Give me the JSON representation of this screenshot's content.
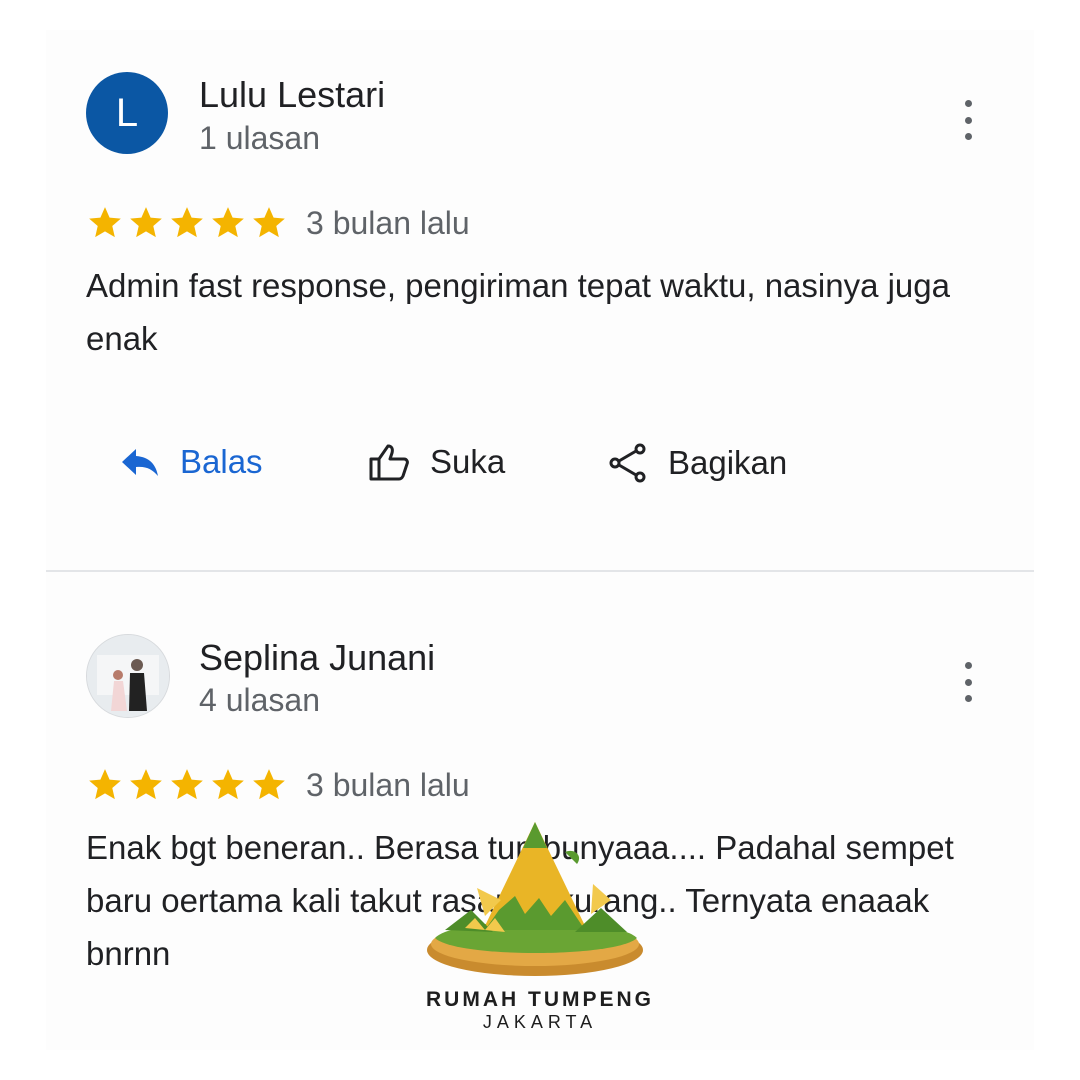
{
  "reviews": [
    {
      "name": "Lulu Lestari",
      "avatar_letter": "L",
      "review_count": "1 ulasan",
      "rating": 5,
      "date": "3 bulan lalu",
      "text": "Admin fast response, pengiriman tepat waktu, nasinya juga enak",
      "actions": {
        "reply": "Balas",
        "like": "Suka",
        "share": "Bagikan"
      }
    },
    {
      "name": "Seplina Junani",
      "review_count": "4 ulasan",
      "rating": 5,
      "date": "3 bulan lalu",
      "text": "Enak bgt beneran.. Berasa tumbunyaaa.... Padahal sempet baru oertama kali takut rasanya kurang.. Ternyata enaaak bnrnn"
    }
  ],
  "logo": {
    "title": "RUMAH TUMPENG",
    "subtitle": "JAKARTA"
  },
  "colors": {
    "star": "#f4b400",
    "reply_blue": "#1a66d2",
    "avatar_blue": "#0b57a4",
    "logo_green": "#5a9a2f",
    "logo_yellow": "#e9b526"
  }
}
